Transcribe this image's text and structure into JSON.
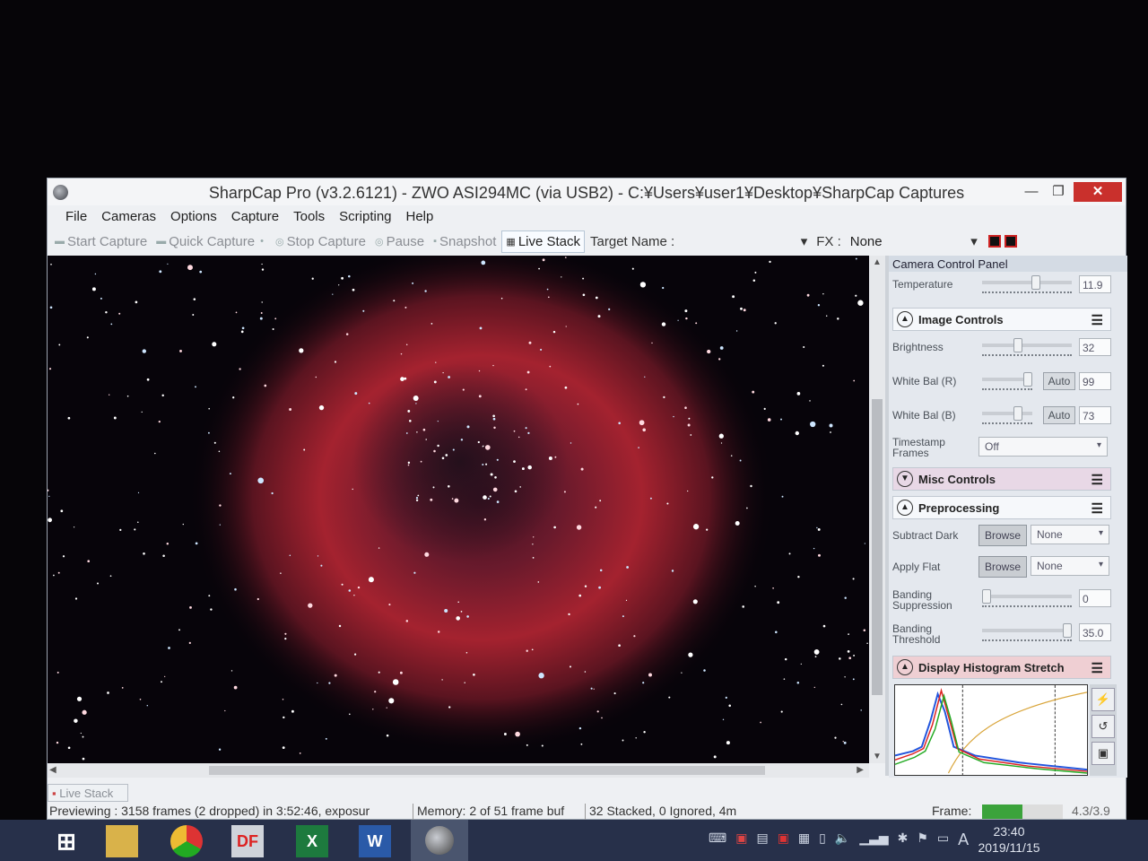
{
  "window": {
    "title": "SharpCap Pro (v3.2.6121) - ZWO ASI294MC (via USB2) - C:¥Users¥user1¥Desktop¥SharpCap Captures",
    "controls": {
      "minimize": "—",
      "maximize": "❐",
      "close": "✕"
    }
  },
  "menu": [
    "File",
    "Cameras",
    "Options",
    "Capture",
    "Tools",
    "Scripting",
    "Help"
  ],
  "toolbar": {
    "start_capture": "Start Capture",
    "quick_capture": "Quick Capture",
    "stop_capture": "Stop Capture",
    "pause": "Pause",
    "snapshot": "Snapshot",
    "live_stack": "Live Stack",
    "target_name_label": "Target Name :",
    "fx_label": "FX :",
    "fx_value": "None"
  },
  "panel": {
    "header": "Camera Control Panel",
    "temperature": {
      "label": "Temperature",
      "value": "11.9",
      "level": 0.6
    },
    "image_controls": {
      "title": "Image Controls",
      "brightness": {
        "label": "Brightness",
        "value": "32",
        "level": 0.4
      },
      "white_bal_r": {
        "label": "White Bal (R)",
        "auto": "Auto",
        "value": "99",
        "level": 0.95
      },
      "white_bal_b": {
        "label": "White Bal (B)",
        "auto": "Auto",
        "value": "73",
        "level": 0.72
      },
      "timestamp_frames": {
        "label": "Timestamp Frames",
        "value": "Off"
      }
    },
    "misc_controls": {
      "title": "Misc Controls"
    },
    "preprocessing": {
      "title": "Preprocessing",
      "subtract_dark": {
        "label": "Subtract Dark",
        "button": "Browse",
        "value": "None"
      },
      "apply_flat": {
        "label": "Apply Flat",
        "button": "Browse",
        "value": "None"
      },
      "banding_suppression": {
        "label": "Banding Suppression",
        "value": "0",
        "level": 0.0
      },
      "banding_threshold": {
        "label": "Banding Threshold",
        "value": "35.0",
        "level": 0.95
      }
    },
    "histogram": {
      "title": "Display Histogram Stretch"
    }
  },
  "bottom_tab": "Live Stack",
  "status": {
    "previewing": "Previewing : 3158 frames (2 dropped) in 3:52:46, exposur",
    "memory": "Memory: 2 of 51 frame buf",
    "stacked": "32 Stacked, 0 Ignored, 4m",
    "frame_label": "Frame:",
    "frame_level": 0.5,
    "fps": "4.3/3.9"
  },
  "taskbar": {
    "time": "23:40",
    "date": "2019/11/15",
    "ime": "A"
  },
  "colors": {
    "close": "#c9302c",
    "nebula": "#b0262e",
    "taskbar": "#27304a",
    "frame_bar": "#3ba33b"
  }
}
